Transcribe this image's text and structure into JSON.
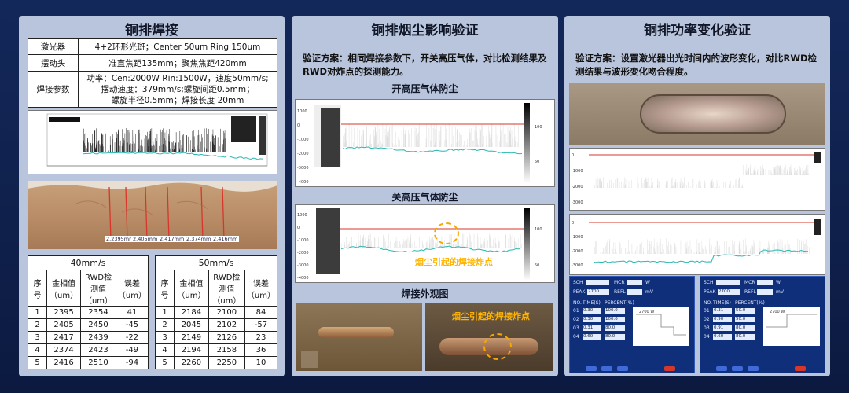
{
  "panel1": {
    "title": "铜排焊接",
    "spec": [
      {
        "key": "激光器",
        "value": "4+2环形光斑；Center 50um  Ring 150um"
      },
      {
        "key": "摆动头",
        "value": "准直焦距135mm；聚焦焦距420mm"
      },
      {
        "key": "焊接参数",
        "value_lines": [
          "功率：Cen:2000W Rin:1500W，速度50mm/s;",
          "摆动速度：379mm/s;螺旋间距0.5mm；",
          "螺旋半径0.5mm；焊接长度 20mm"
        ]
      }
    ],
    "weld_labels": [
      "2.2395mm",
      "2.405mm",
      "2.417mm",
      "2.374mm",
      "2.416mm"
    ],
    "table40": {
      "title": "40mm/s",
      "headers": [
        "序号",
        "金相值（um）",
        "RWD检测值（um）",
        "误差（um）"
      ],
      "rows": [
        [
          "1",
          "2395",
          "2354",
          "41"
        ],
        [
          "2",
          "2405",
          "2450",
          "-45"
        ],
        [
          "3",
          "2417",
          "2439",
          "-22"
        ],
        [
          "4",
          "2374",
          "2423",
          "-49"
        ],
        [
          "5",
          "2416",
          "2510",
          "-94"
        ]
      ]
    },
    "table50": {
      "title": "50mm/s",
      "headers": [
        "序号",
        "金相值（um）",
        "RWD检测值（um）",
        "误差（um）"
      ],
      "rows": [
        [
          "1",
          "2184",
          "2100",
          "84"
        ],
        [
          "2",
          "2045",
          "2102",
          "-57"
        ],
        [
          "3",
          "2149",
          "2126",
          "23"
        ],
        [
          "4",
          "2194",
          "2158",
          "36"
        ],
        [
          "5",
          "2260",
          "2250",
          "10"
        ]
      ]
    }
  },
  "panel2": {
    "title": "铜排烟尘影响验证",
    "desc": "验证方案：相同焊接参数下，开关高压气体，对比检测结果及RWD对炸点的探测能力。",
    "chart_on_label": "开高压气体防尘",
    "chart_off_label": "关高压气体防尘",
    "appearance_label": "焊接外观图",
    "annotation": "烟尘引起的焊接炸点",
    "y_ticks": [
      "1000",
      "0",
      "-1000",
      "-2000",
      "-3000",
      "-4000"
    ],
    "bar_ticks": [
      "100",
      "50"
    ]
  },
  "panel3": {
    "title": "铜排功率变化验证",
    "desc": "验证方案：设置激光器出光时间内的波形变化，对比RWD检测结果与波形变化吻合程度。",
    "y_ticks": [
      "0",
      "-1000",
      "-2000",
      "-3000"
    ],
    "hmi": [
      {
        "sch": "SCH",
        "mcr": "MCR",
        "peak": "PEAK",
        "peak_val": "2700",
        "refl": "REFL",
        "unit_w": "W",
        "unit_mv": "mV",
        "no": "NO.",
        "time": "TIME(S)",
        "percent": "PERCENT(%)",
        "rows": [
          [
            "01",
            "0.30",
            "100.0"
          ],
          [
            "02",
            "0.30",
            "100.0"
          ],
          [
            "03",
            "0.31",
            "80.0"
          ],
          [
            "04",
            "0.60",
            "80.0"
          ]
        ],
        "wave_label": "2700 W"
      },
      {
        "sch": "SCH",
        "mcr": "MCR",
        "peak": "PEAK",
        "peak_val": "2700",
        "refl": "REFL",
        "unit_w": "W",
        "unit_mv": "mV",
        "no": "NO.",
        "time": "TIME(S)",
        "percent": "PERCENT(%)",
        "rows": [
          [
            "01",
            "0.31",
            "50.0"
          ],
          [
            "02",
            "0.90",
            "50.0"
          ],
          [
            "03",
            "0.91",
            "80.0"
          ],
          [
            "04",
            "0.60",
            "80.0"
          ]
        ],
        "wave_label": "2700 W"
      }
    ]
  },
  "colors": {
    "accent": "#e23b2b",
    "trace": "#2ab7b0",
    "highlight": "#ffb400",
    "bg": "#0f1e46",
    "panel": "#b9c5dc"
  }
}
